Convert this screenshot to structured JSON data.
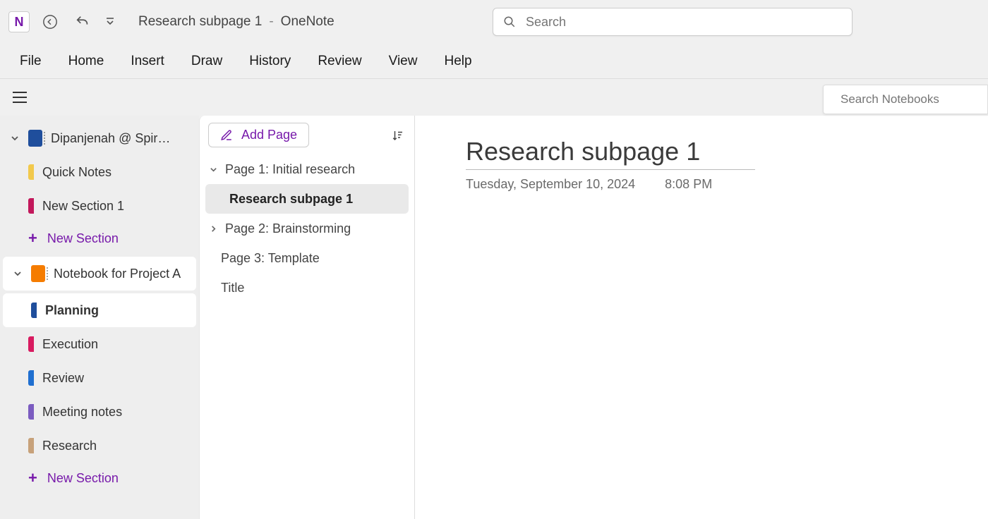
{
  "titlebar": {
    "doc_title": "Research subpage 1",
    "separator": "-",
    "app_name": "OneNote",
    "search_placeholder": "Search"
  },
  "ribbon": [
    "File",
    "Home",
    "Insert",
    "Draw",
    "History",
    "Review",
    "View",
    "Help"
  ],
  "subbar": {
    "search_notebooks_placeholder": "Search Notebooks"
  },
  "sidebar": {
    "notebooks": [
      {
        "name": "Dipanjenah @ Spiral...",
        "color": "#1f4e9c",
        "expanded": true,
        "selected": false,
        "sections": [
          {
            "name": "Quick Notes",
            "color": "#f2c94c"
          },
          {
            "name": "New Section 1",
            "color": "#c2185b"
          }
        ],
        "new_section_label": "New Section"
      },
      {
        "name": "Notebook for Project A",
        "color": "#f57c00",
        "expanded": true,
        "selected": true,
        "sections": [
          {
            "name": "Planning",
            "color": "#1f4e9c",
            "active": true
          },
          {
            "name": "Execution",
            "color": "#d81b60"
          },
          {
            "name": "Review",
            "color": "#1f6fd0"
          },
          {
            "name": "Meeting notes",
            "color": "#7b5cc0"
          },
          {
            "name": "Research",
            "color": "#c7a17a"
          }
        ],
        "new_section_label": "New Section"
      }
    ]
  },
  "pages": {
    "add_page_label": "Add Page",
    "items": [
      {
        "label": "Page 1: Initial research",
        "chevron": "down"
      },
      {
        "label": "Research subpage 1",
        "sub": true,
        "selected": true
      },
      {
        "label": "Page 2: Brainstorming",
        "chevron": "right"
      },
      {
        "label": "Page 3: Template"
      },
      {
        "label": "Title"
      }
    ]
  },
  "editor": {
    "title": "Research subpage 1",
    "date": "Tuesday, September 10, 2024",
    "time": "8:08 PM"
  }
}
